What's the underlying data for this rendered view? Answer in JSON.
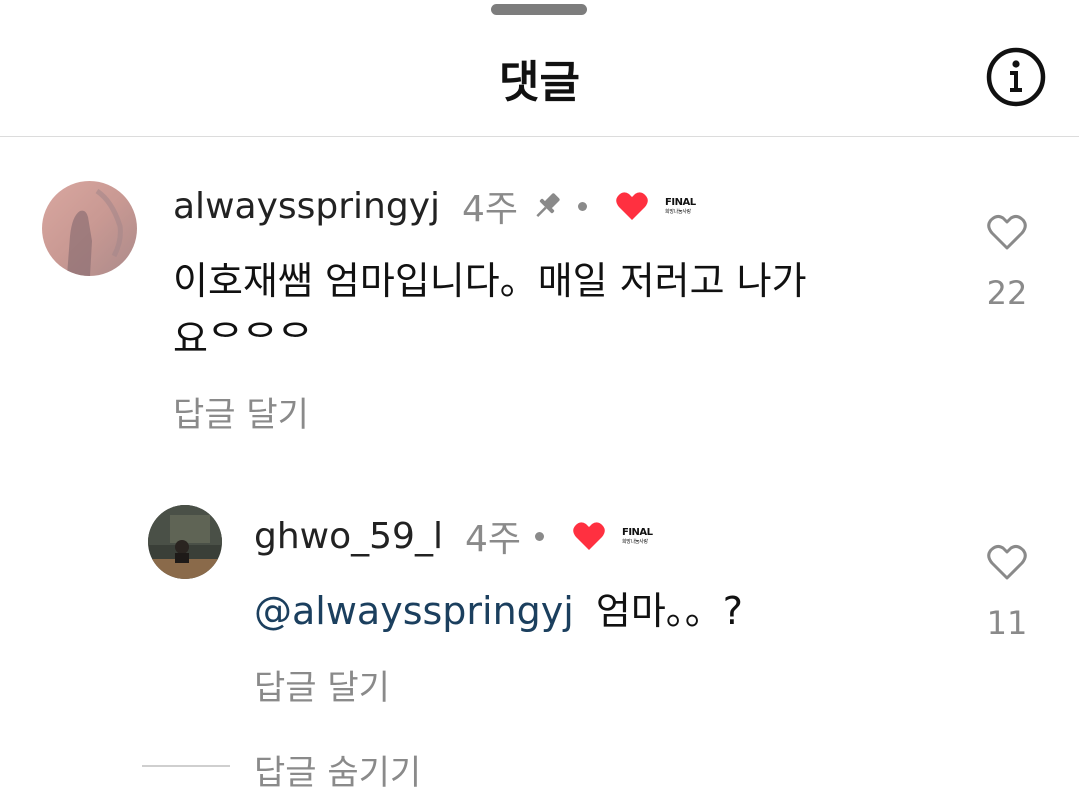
{
  "header": {
    "title": "댓글",
    "info_icon": "info-circle-icon"
  },
  "comments": [
    {
      "username": "alwaysspringyj",
      "time": "4주",
      "pinned": true,
      "creator_liked": true,
      "badge": {
        "line1": "FINAL",
        "line2": "희망나눔사랑"
      },
      "text": "이호재쌤 엄마입니다。매일 저러고 나가요ᄋᄋᄋ",
      "reply_label": "답글 달기",
      "likes": "22"
    }
  ],
  "replies": [
    {
      "username": "ghwo_59_l",
      "time": "4주",
      "creator_liked": true,
      "badge": {
        "line1": "FINAL",
        "line2": "희망나눔사랑"
      },
      "mention": "@alwaysspringyj",
      "text": "엄마。。?",
      "reply_label": "답글 달기",
      "likes": "11"
    }
  ],
  "hide_replies_label": "답글 숨기기",
  "colors": {
    "heart_red": "#ff3040",
    "mention": "#1b3f5e",
    "muted": "#8a8a8a"
  }
}
